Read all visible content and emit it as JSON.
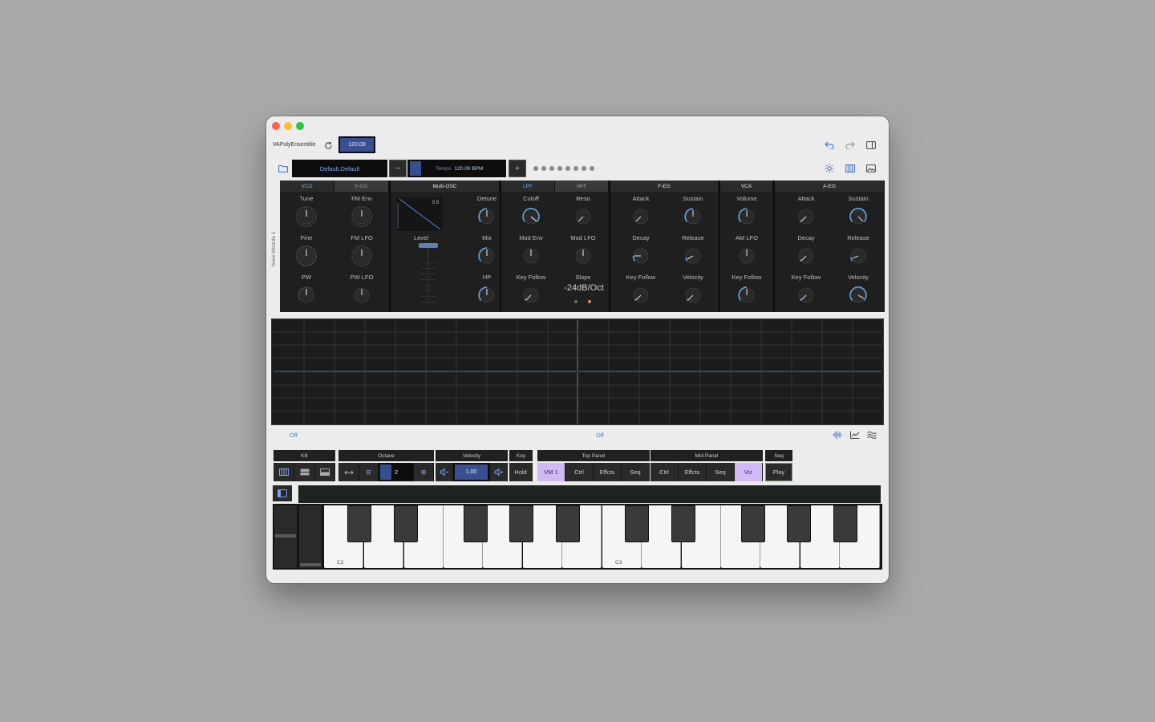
{
  "app": {
    "name": "VAPolyEnsemble",
    "tempo_value": "120.00",
    "preset": "Default.Default",
    "tempo_label": "Tempo",
    "tempo_bpm": "120.00 BPM",
    "preset_dots": 8
  },
  "synth": {
    "side_label": "Voice Module 1",
    "sections": {
      "vco": {
        "tabs": [
          "VCO",
          "P-EG"
        ],
        "knobs": [
          "Tune",
          "FM Env",
          "Fine",
          "FM LFO",
          "PW",
          "PW LFO"
        ]
      },
      "multi_osc": {
        "title": "Multi-OSC",
        "display_value": "0.5",
        "level_label": "Level",
        "knobs": [
          "Detune",
          "Mix",
          "HP"
        ]
      },
      "filter": {
        "tabs": [
          "LPF",
          "HPF"
        ],
        "knobs": [
          "Cutoff",
          "Reso",
          "Mod Env",
          "Mod LFO",
          "Key Follow"
        ],
        "slope_label": "Slope",
        "slope_value": "-24dB/Oct"
      },
      "feg": {
        "title": "F-EG",
        "knobs": [
          "Attack",
          "Sustain",
          "Decay",
          "Release",
          "Key Follow",
          "Velocity"
        ]
      },
      "vca": {
        "title": "VCA",
        "knobs": [
          "Volume",
          "AM LFO",
          "Key Follow"
        ]
      },
      "aeg": {
        "title": "A-EG",
        "knobs": [
          "Attack",
          "Sustain",
          "Decay",
          "Release",
          "Key Follow",
          "Velocity"
        ]
      }
    }
  },
  "viz": {
    "left_status": "Off",
    "right_status": "Off"
  },
  "controls": {
    "kb": {
      "title": "KB"
    },
    "octave": {
      "title": "Octave",
      "value": "2"
    },
    "velocity": {
      "title": "Velocity",
      "value": "1.00"
    },
    "key": {
      "title": "Key",
      "hold": "Hold"
    },
    "top_panel": {
      "title": "Top Panel",
      "items": [
        "VM 1",
        "Ctrl",
        "Effcts",
        "Seq"
      ]
    },
    "mid_panel": {
      "title": "Mid Panel",
      "items": [
        "Ctrl",
        "Effcts",
        "Seq",
        "Viz"
      ]
    },
    "seq": {
      "title": "Seq",
      "play": "Play"
    }
  },
  "keyboard": {
    "labels": [
      "C2",
      "C3"
    ]
  },
  "colors": {
    "accent": "#5fb4ff",
    "selected": "#d2b8f5",
    "panel": "#1f1f1f"
  }
}
